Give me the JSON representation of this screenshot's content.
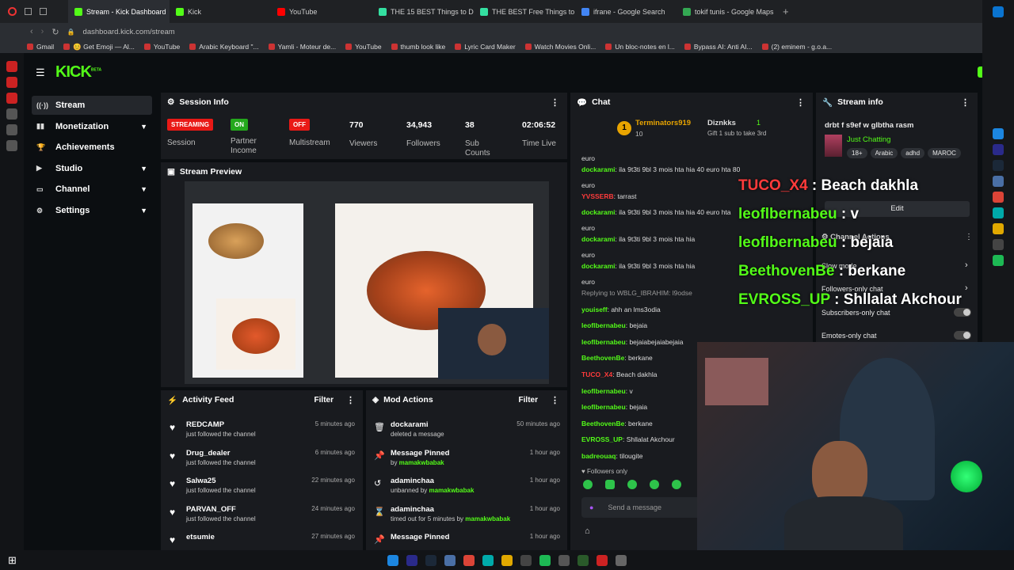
{
  "browser": {
    "tabs": [
      {
        "title": "Stream - Kick Dashboard",
        "color": "#53fc18"
      },
      {
        "title": "Kick",
        "color": "#53fc18"
      },
      {
        "title": "YouTube",
        "color": "#ff0000"
      },
      {
        "title": "THE 15 BEST Things to D",
        "color": "#34e0a1"
      },
      {
        "title": "THE BEST Free Things to",
        "color": "#34e0a1"
      },
      {
        "title": "ifrane - Google Search",
        "color": "#4285f4"
      },
      {
        "title": "tokif tunis - Google Maps",
        "color": "#34a853"
      }
    ],
    "url": "dashboard.kick.com/stream",
    "bookmarks": [
      "Gmail",
      "😊 Get Emoji — Al...",
      "YouTube",
      "Arabic Keyboard \"...",
      "Yamli - Moteur de...",
      "YouTube",
      "thumb look like",
      "Lyric Card Maker",
      "Watch Movies Onli...",
      "Un bloc-notes en l...",
      "Bypass AI: Anti AI...",
      "(2) eminem - g.o.a..."
    ]
  },
  "app": {
    "logo": "KICK",
    "logo_sup": "BETA"
  },
  "sidebar": {
    "items": [
      {
        "label": "Stream",
        "icon": "signal-icon"
      },
      {
        "label": "Monetization",
        "icon": "chart-icon"
      },
      {
        "label": "Achievements",
        "icon": "trophy-icon"
      },
      {
        "label": "Studio",
        "icon": "video-icon"
      },
      {
        "label": "Channel",
        "icon": "tv-icon"
      },
      {
        "label": "Settings",
        "icon": "gear-icon"
      }
    ]
  },
  "session": {
    "title": "Session Info",
    "streaming": "STREAMING",
    "session_label": "Session",
    "partner_state": "ON",
    "partner_label": "Partner Income",
    "multistream_state": "OFF",
    "multistream_label": "Multistream",
    "viewers": "770",
    "viewers_label": "Viewers",
    "followers": "34,943",
    "followers_label": "Followers",
    "subs": "38",
    "subs_label": "Sub Counts",
    "time": "02:06:52",
    "time_label": "Time Live"
  },
  "preview": {
    "title": "Stream Preview"
  },
  "activity": {
    "title": "Activity Feed",
    "filter": "Filter",
    "rows": [
      {
        "name": "REDCAMP",
        "desc": "just followed the channel",
        "time": "5 minutes ago"
      },
      {
        "name": "Drug_dealer",
        "desc": "just followed the channel",
        "time": "6 minutes ago"
      },
      {
        "name": "Salwa25",
        "desc": "just followed the channel",
        "time": "22 minutes ago"
      },
      {
        "name": "PARVAN_OFF",
        "desc": "just followed the channel",
        "time": "24 minutes ago"
      },
      {
        "name": "etsumie",
        "desc": "",
        "time": "27 minutes ago"
      }
    ]
  },
  "mod": {
    "title": "Mod Actions",
    "filter": "Filter",
    "rows": [
      {
        "name": "dockarami",
        "desc": "deleted a message",
        "by": "",
        "time": "50 minutes ago",
        "icon": "trash-icon"
      },
      {
        "name": "Message Pinned",
        "desc": "by ",
        "by": "mamakwbabak",
        "time": "1 hour ago",
        "icon": "pin-icon"
      },
      {
        "name": "adaminchaa",
        "desc": "unbanned by ",
        "by": "mamakwbabak",
        "time": "1 hour ago",
        "icon": "undo-icon"
      },
      {
        "name": "adaminchaa",
        "desc": "timed out for 5 minutes by ",
        "by": "mamakwbabak",
        "time": "1 hour ago",
        "icon": "hourglass-icon"
      },
      {
        "name": "Message Pinned",
        "desc": "",
        "by": "",
        "time": "1 hour ago",
        "icon": "pin-icon"
      }
    ]
  },
  "chat": {
    "title": "Chat",
    "top_gifter": "Terminators919",
    "top_gifter_count": "10",
    "second_gifter": "Diznkks",
    "second_count": "1",
    "gift_hint": "Gift 1 sub to take 3rd",
    "messages": [
      {
        "user": "",
        "text": "euro",
        "color": "#ddd"
      },
      {
        "user": "dockarami",
        "text": ": ila 9t3ti 9bl 3 mois hta hia 40 euro hta 80",
        "color": "#53fc18"
      },
      {
        "user": "",
        "text": "euro",
        "color": "#ddd"
      },
      {
        "user": "YVSSERB",
        "text": ": tarrast",
        "color": "#ff3b3b"
      },
      {
        "user": "dockarami",
        "text": ": ila 9t3ti 9bl 3 mois hta hia 40 euro hta",
        "color": "#53fc18"
      },
      {
        "user": "",
        "text": "euro",
        "color": "#ddd"
      },
      {
        "user": "dockarami",
        "text": ": ila 9t3ti 9bl 3 mois hta hia",
        "color": "#53fc18"
      },
      {
        "user": "",
        "text": "euro",
        "color": "#ddd"
      },
      {
        "user": "dockarami",
        "text": ": ila 9t3ti 9bl 3 mois hta hia",
        "color": "#53fc18"
      },
      {
        "user": "",
        "text": "euro",
        "color": "#ddd"
      },
      {
        "user": "",
        "text": "Replying to WBLG_IBRAHIM: l9odse",
        "color": "#999"
      },
      {
        "user": "youiseff",
        "text": ": ahh an lms3odia",
        "color": "#53fc18"
      },
      {
        "user": "leoflbernabeu",
        "text": ": bejaia",
        "color": "#53fc18"
      },
      {
        "user": "leoflbernabeu",
        "text": ": bejaiabejaiabejaia",
        "color": "#53fc18"
      },
      {
        "user": "BeethovenBe",
        "text": ": berkane",
        "color": "#53fc18"
      },
      {
        "user": "TUCO_X4",
        "text": ": Beach dakhla",
        "color": "#ff3b3b"
      },
      {
        "user": "leoflbernabeu",
        "text": ": v",
        "color": "#53fc18"
      },
      {
        "user": "leoflbernabeu",
        "text": ": bejaia",
        "color": "#53fc18"
      },
      {
        "user": "BeethovenBe",
        "text": ": berkane",
        "color": "#53fc18"
      },
      {
        "user": "EVROSS_UP",
        "text": ": Shllalat Akchour",
        "color": "#53fc18"
      },
      {
        "user": "badreouaq",
        "text": ": tilougite",
        "color": "#53fc18"
      }
    ],
    "followers_only": "Followers only",
    "send_placeholder": "Send a message"
  },
  "streaminfo": {
    "title": "Stream info",
    "stream_title": "drbt f s9ef w glbtha rasm",
    "category": "Just Chatting",
    "tags": [
      "18+",
      "Arabic",
      "adhd",
      "MAROC"
    ],
    "edit": "Edit",
    "channel_actions": "Channel Actions",
    "slow_mode": "Slow mode",
    "followers_only_chat": "Followers-only chat",
    "subscribers_only_chat": "Subscribers-only chat",
    "emotes_only_chat": "Emotes-only chat"
  },
  "overlay": [
    {
      "user": "TUCO_X4",
      "text": " : Beach dakhla",
      "color": "#ff3b3b"
    },
    {
      "user": "leoflbernabeu",
      "text": " : v",
      "color": "#53fc18"
    },
    {
      "user": "leoflbernabeu",
      "text": " : bejaia",
      "color": "#53fc18"
    },
    {
      "user": "BeethovenBe",
      "text": " : berkane",
      "color": "#53fc18"
    },
    {
      "user": "EVROSS_UP",
      "text": " : Shllalat Akchour",
      "color": "#53fc18"
    }
  ],
  "colors": {
    "accent": "#53fc18",
    "danger": "#e91916",
    "panel": "#191b1f"
  }
}
